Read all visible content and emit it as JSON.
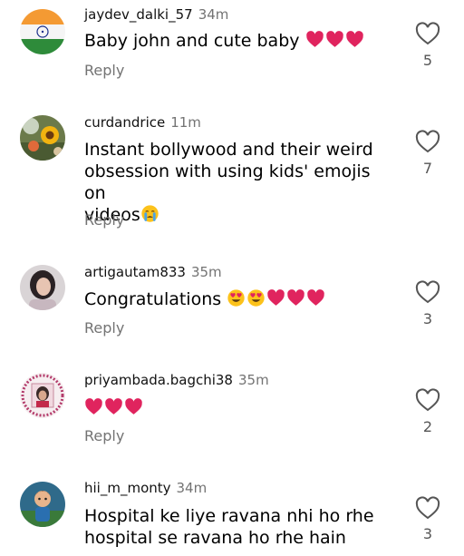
{
  "comments": [
    {
      "username": "jaydev_dalki_57",
      "time": "34m",
      "text": "Baby john and cute baby",
      "emojis": [
        "heart",
        "heart",
        "heart"
      ],
      "reply_label": "Reply",
      "likes": "5",
      "avatar": "india-flag-avatar"
    },
    {
      "username": "curdandrice",
      "time": "11m",
      "text_lines": [
        "Instant bollywood and their weird",
        "obsession with using kids' emojis on",
        "videos"
      ],
      "emojis": [
        "crying-face"
      ],
      "reply_label": "Reply",
      "likes": "7",
      "avatar": "sunflower-avatar"
    },
    {
      "username": "artigautam833",
      "time": "35m",
      "text": "Congratulations",
      "emojis": [
        "heart-eyes",
        "heart-eyes",
        "heart",
        "heart",
        "heart"
      ],
      "reply_label": "Reply",
      "likes": "3",
      "avatar": "woman-photo-avatar"
    },
    {
      "username": "priyambada.bagchi38",
      "time": "35m",
      "text": "",
      "emojis": [
        "heart",
        "heart",
        "heart"
      ],
      "reply_label": "Reply",
      "likes": "2",
      "avatar": "framed-portrait-avatar"
    },
    {
      "username": "hii_m_monty",
      "time": "34m",
      "text_lines": [
        "Hospital ke liye ravana nhi ho rhe",
        "hospital se ravana ho rhe hain"
      ],
      "reply_label": "",
      "likes": "3",
      "avatar": "cartoon-boy-avatar"
    }
  ],
  "colors": {
    "heart": "#e0245e",
    "emoji_face": "#fcc21b",
    "secondary_text": "#737373"
  }
}
